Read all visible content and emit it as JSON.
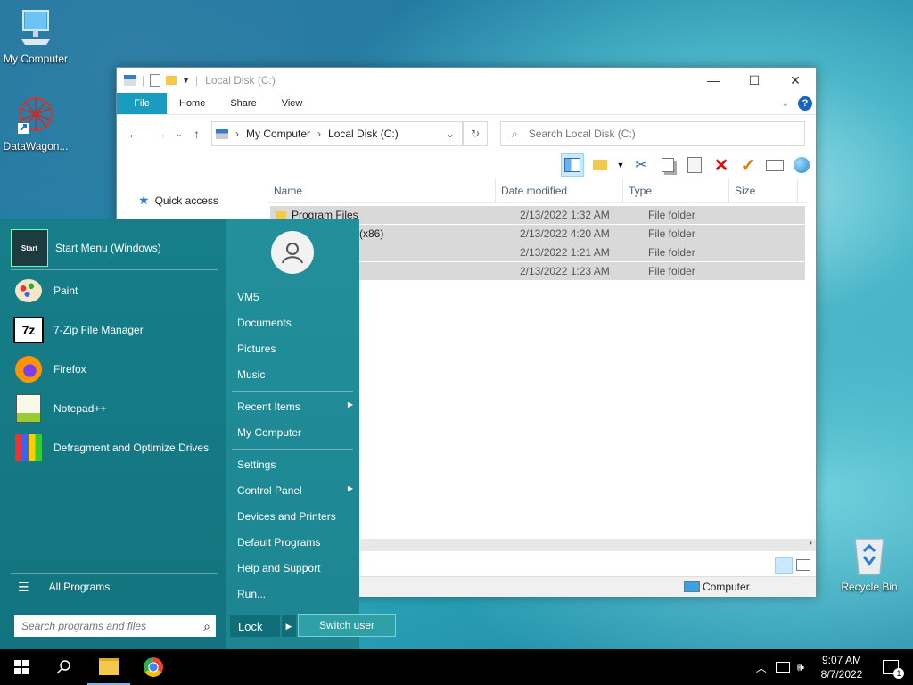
{
  "desktop": {
    "icons": [
      {
        "label": "My Computer"
      },
      {
        "label": "DataWagon..."
      },
      {
        "label": "Recycle Bin"
      }
    ]
  },
  "explorer": {
    "title": "Local Disk (C:)",
    "tabs": {
      "file": "File",
      "home": "Home",
      "share": "Share",
      "view": "View"
    },
    "address": {
      "segments": [
        "My Computer",
        "Local Disk (C:)"
      ]
    },
    "search_placeholder": "Search Local Disk (C:)",
    "columns": {
      "name": "Name",
      "date": "Date modified",
      "type": "Type",
      "size": "Size"
    },
    "nav": {
      "quick_access": "Quick access"
    },
    "rows": [
      {
        "name": "Program Files",
        "date": "2/13/2022 1:32 AM",
        "type": "File folder"
      },
      {
        "name": "(x86)",
        "date": "2/13/2022 4:20 AM",
        "type": "File folder"
      },
      {
        "name": "",
        "date": "2/13/2022 1:21 AM",
        "type": "File folder"
      },
      {
        "name": "",
        "date": "2/13/2022 1:23 AM",
        "type": "File folder"
      }
    ],
    "status_computer": "Computer"
  },
  "start_menu": {
    "pinned": [
      {
        "label": "Start Menu (Windows)",
        "icon": "start-menu-icon"
      },
      {
        "label": "Paint",
        "icon": "paint-icon"
      },
      {
        "label": "7-Zip File Manager",
        "icon": "7zip-icon"
      },
      {
        "label": "Firefox",
        "icon": "firefox-icon"
      },
      {
        "label": "Notepad++",
        "icon": "notepadpp-icon"
      },
      {
        "label": "Defragment and Optimize Drives",
        "icon": "defrag-icon"
      }
    ],
    "all_programs": "All Programs",
    "search_placeholder": "Search programs and files",
    "right": {
      "user": "VM5",
      "documents": "Documents",
      "pictures": "Pictures",
      "music": "Music",
      "recent": "Recent Items",
      "computer": "My Computer",
      "settings": "Settings",
      "control_panel": "Control Panel",
      "devices": "Devices and Printers",
      "default_programs": "Default Programs",
      "help": "Help and Support",
      "run": "Run..."
    },
    "lock": "Lock",
    "switch_user": "Switch user",
    "start_icon_text": "Start"
  },
  "taskbar": {
    "time": "9:07 AM",
    "date": "8/7/2022",
    "notification_count": "1"
  },
  "colors": {
    "accent": "#1a9cbf",
    "start_bg": "#1f8d99"
  }
}
